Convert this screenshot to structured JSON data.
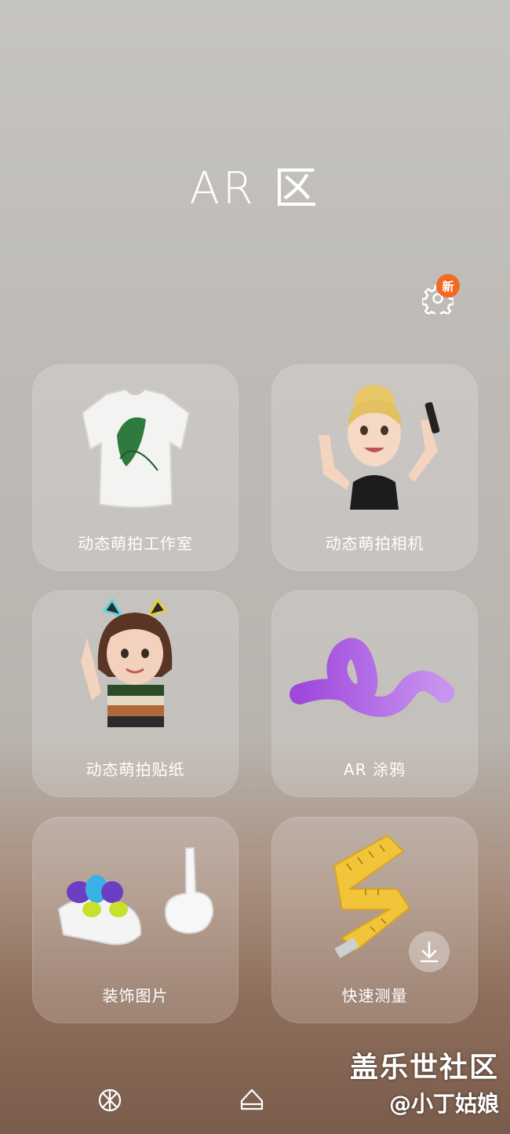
{
  "header": {
    "title": "AR 区"
  },
  "settings": {
    "badge": "新"
  },
  "cards": [
    {
      "label": "动态萌拍工作室",
      "icon": "tshirt-icon"
    },
    {
      "label": "动态萌拍相机",
      "icon": "avatar-selfie-icon"
    },
    {
      "label": "动态萌拍贴纸",
      "icon": "avatar-sticker-icon"
    },
    {
      "label": "AR 涂鸦",
      "icon": "ar-doodle-icon"
    },
    {
      "label": "装饰图片",
      "icon": "deco-picture-icon"
    },
    {
      "label": "快速测量",
      "icon": "tape-measure-icon"
    }
  ],
  "nav": {
    "icons": [
      "aperture-icon",
      "shape-icon"
    ]
  },
  "watermark": {
    "line1": "盖乐世社区",
    "line2": "@小丁姑娘"
  }
}
